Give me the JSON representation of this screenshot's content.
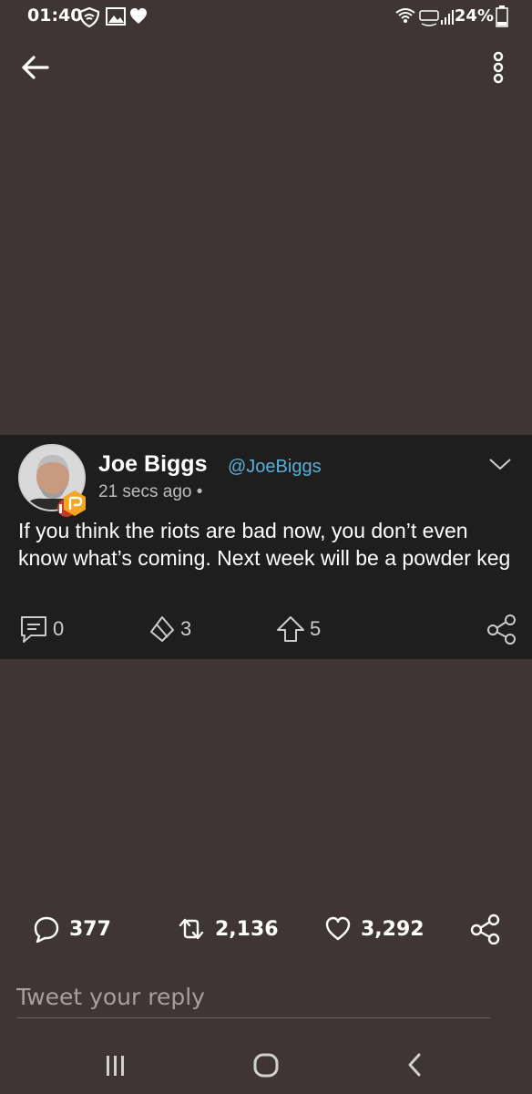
{
  "status_bar": {
    "time": "01:40",
    "battery": "24%"
  },
  "post": {
    "author_name": "Joe Biggs",
    "author_handle": "@JoeBiggs",
    "time_ago": "21 secs ago •",
    "text": "If you think the riots are bad now, you don’t even know what’s coming. Next week will be a powder keg",
    "comments": "0",
    "echoes": "3",
    "upvotes": "5"
  },
  "tweet": {
    "replies": "377",
    "retweets": "2,136",
    "likes": "3,292"
  },
  "reply": {
    "placeholder": "Tweet your reply"
  },
  "icons": {
    "back": "back-arrow-icon",
    "more": "more-vertical-icon",
    "comment": "comment-icon",
    "echo": "echo-icon",
    "upvote": "upvote-icon",
    "share": "share-icon",
    "reply": "reply-icon",
    "retweet": "retweet-icon",
    "like": "heart-icon"
  },
  "colors": {
    "background": "#3e3534",
    "card": "#1f1e1e",
    "handle": "#5aaed6",
    "badge_orange": "#f5a623",
    "badge_red": "#c0392b"
  }
}
